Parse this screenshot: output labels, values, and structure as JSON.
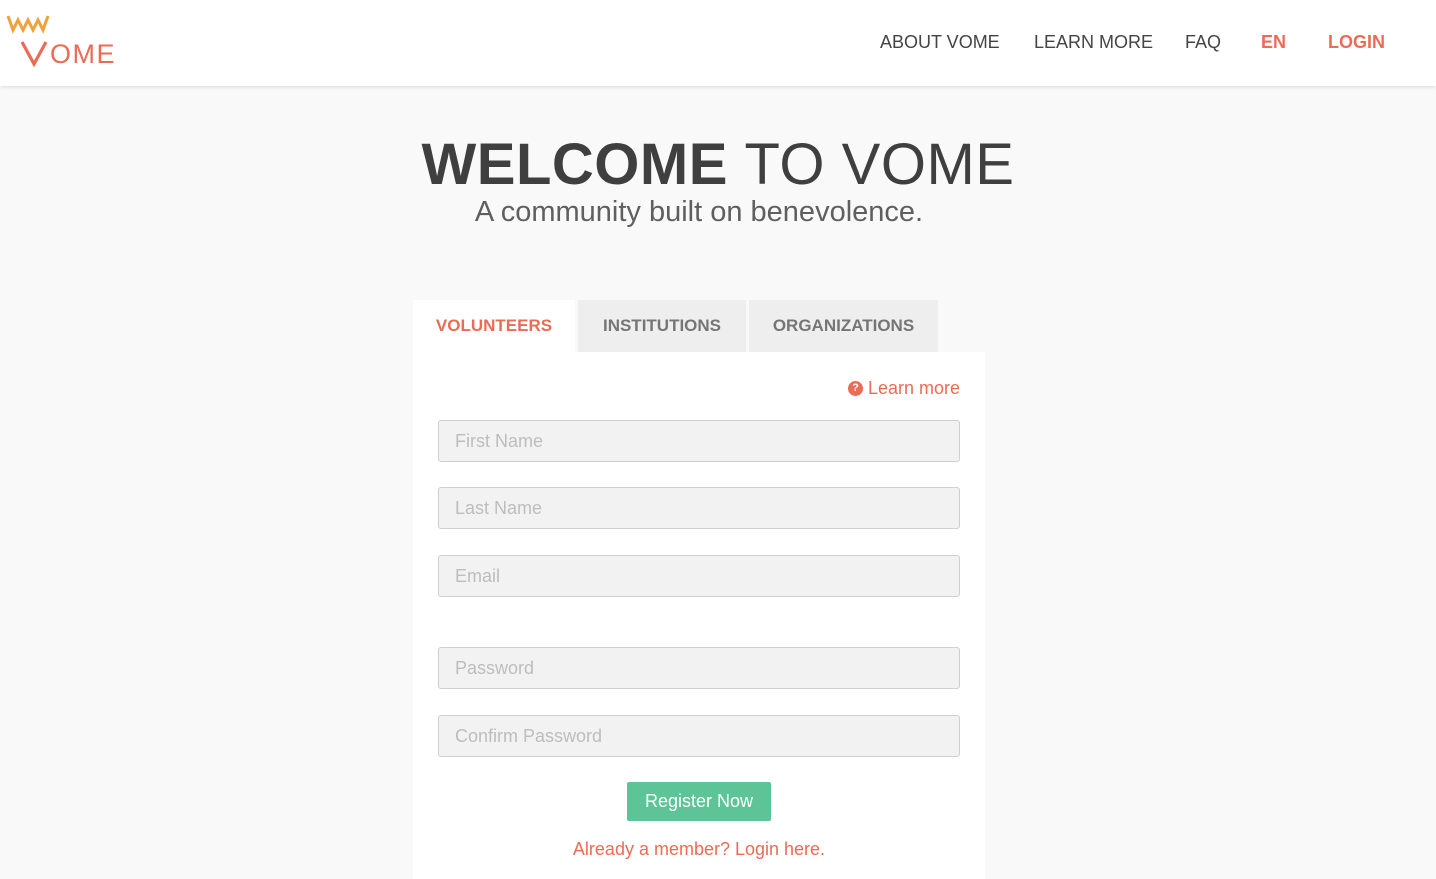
{
  "header": {
    "logo_text": "VOME",
    "nav": {
      "about": "ABOUT VOME",
      "learn_more": "LEARN MORE",
      "faq": "FAQ",
      "language": "EN",
      "login": "LOGIN"
    }
  },
  "hero": {
    "title_strong": "WELCOME",
    "title_light": "TO VOME",
    "subtitle": "A community built on benevolence."
  },
  "tabs": [
    {
      "label": "VOLUNTEERS",
      "active": true
    },
    {
      "label": "INSTITUTIONS",
      "active": false
    },
    {
      "label": "ORGANIZATIONS",
      "active": false
    }
  ],
  "form": {
    "learn_more": "Learn more",
    "learn_more_icon": "question-circle-icon",
    "first_name_placeholder": "First Name",
    "last_name_placeholder": "Last Name",
    "email_placeholder": "Email",
    "password_placeholder": "Password",
    "confirm_password_placeholder": "Confirm Password",
    "register_label": "Register Now",
    "already_member": "Already a member? Login here."
  },
  "colors": {
    "accent": "#ec6b55",
    "logo_orange": "#f0a13a",
    "button_green": "#5cc497",
    "background": "#f9f9f9"
  }
}
